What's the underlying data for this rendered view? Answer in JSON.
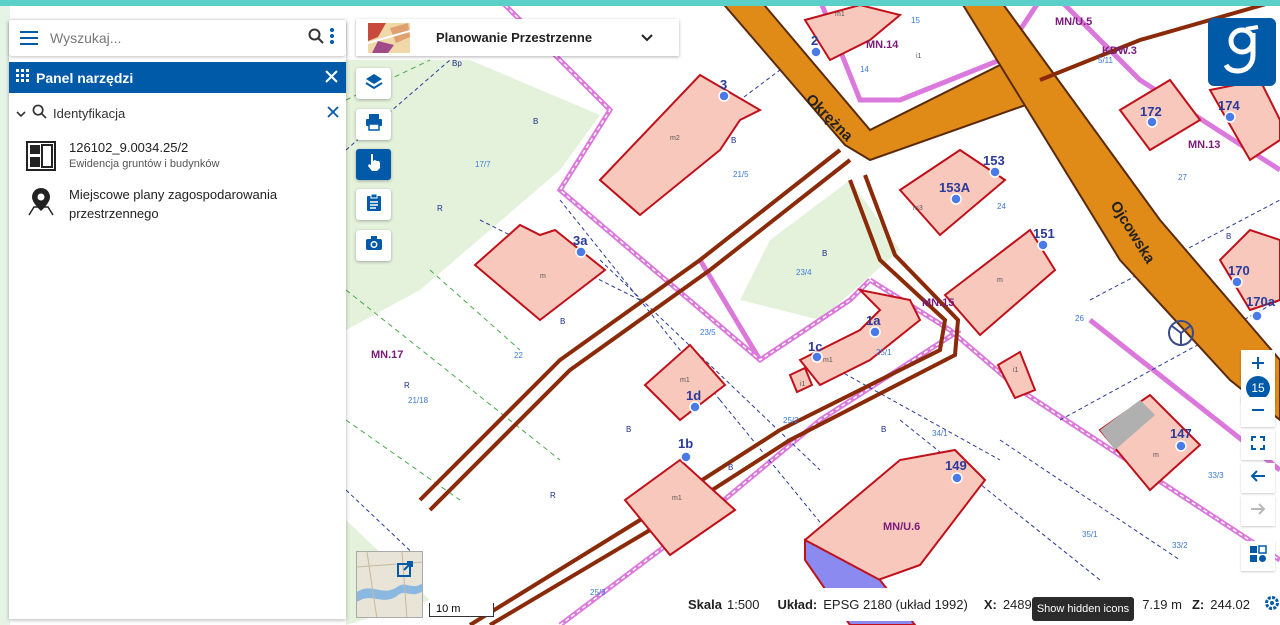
{
  "search": {
    "placeholder": "Wyszukaj..."
  },
  "toolpanel": {
    "title": "Panel narzędzi"
  },
  "identification": {
    "label": "Identyfikacja"
  },
  "results": [
    {
      "title": "126102_9.0034.25/2",
      "subtitle": "Ewidencja gruntów i budynków"
    },
    {
      "title": "Miejscowe plany zagospodarowania przestrzennego",
      "subtitle": ""
    }
  ],
  "layer_selector": {
    "label": "Planowanie Przestrzenne"
  },
  "zoom": {
    "level": "15"
  },
  "status": {
    "scale_label": "Skala",
    "scale_value": "1:500",
    "crs_label": "Układ:",
    "crs_value": "EPSG 2180 (układ 1992)",
    "x_label": "X:",
    "x_value": "24898",
    "y_value": "7.19 m",
    "z_label": "Z:",
    "z_value": "244.02"
  },
  "tooltip": {
    "text": "Show hidden icons"
  },
  "scalebar": {
    "label": "10 m"
  },
  "map": {
    "streets": [
      "Okrężna",
      "Ojcowska"
    ],
    "zone_labels": [
      "MN/U.5",
      "KDW.3",
      "MN.14",
      "MN.13",
      "MN.15",
      "MN.17",
      "MN/U.6"
    ],
    "address_labels": [
      "2",
      "3",
      "3a",
      "153",
      "153A",
      "151",
      "172",
      "174",
      "170",
      "170a",
      "1a",
      "1c",
      "1d",
      "1b",
      "149",
      "147"
    ],
    "parcel_labels": [
      "Bp",
      "17/7",
      "21/5",
      "23/4",
      "23/5",
      "22",
      "21/18",
      "25/1",
      "25/2",
      "34/1",
      "33/3",
      "35/1",
      "33/2",
      "25/3",
      "27",
      "26",
      "24",
      "14",
      "15",
      "5/11"
    ],
    "colors": {
      "building": "#f8c8bc",
      "building_border": "#c0101a",
      "street": "#e08a18",
      "street_border": "#5a2a08",
      "plan_border": "#d86ad8",
      "green": "#e4f2dc"
    }
  }
}
